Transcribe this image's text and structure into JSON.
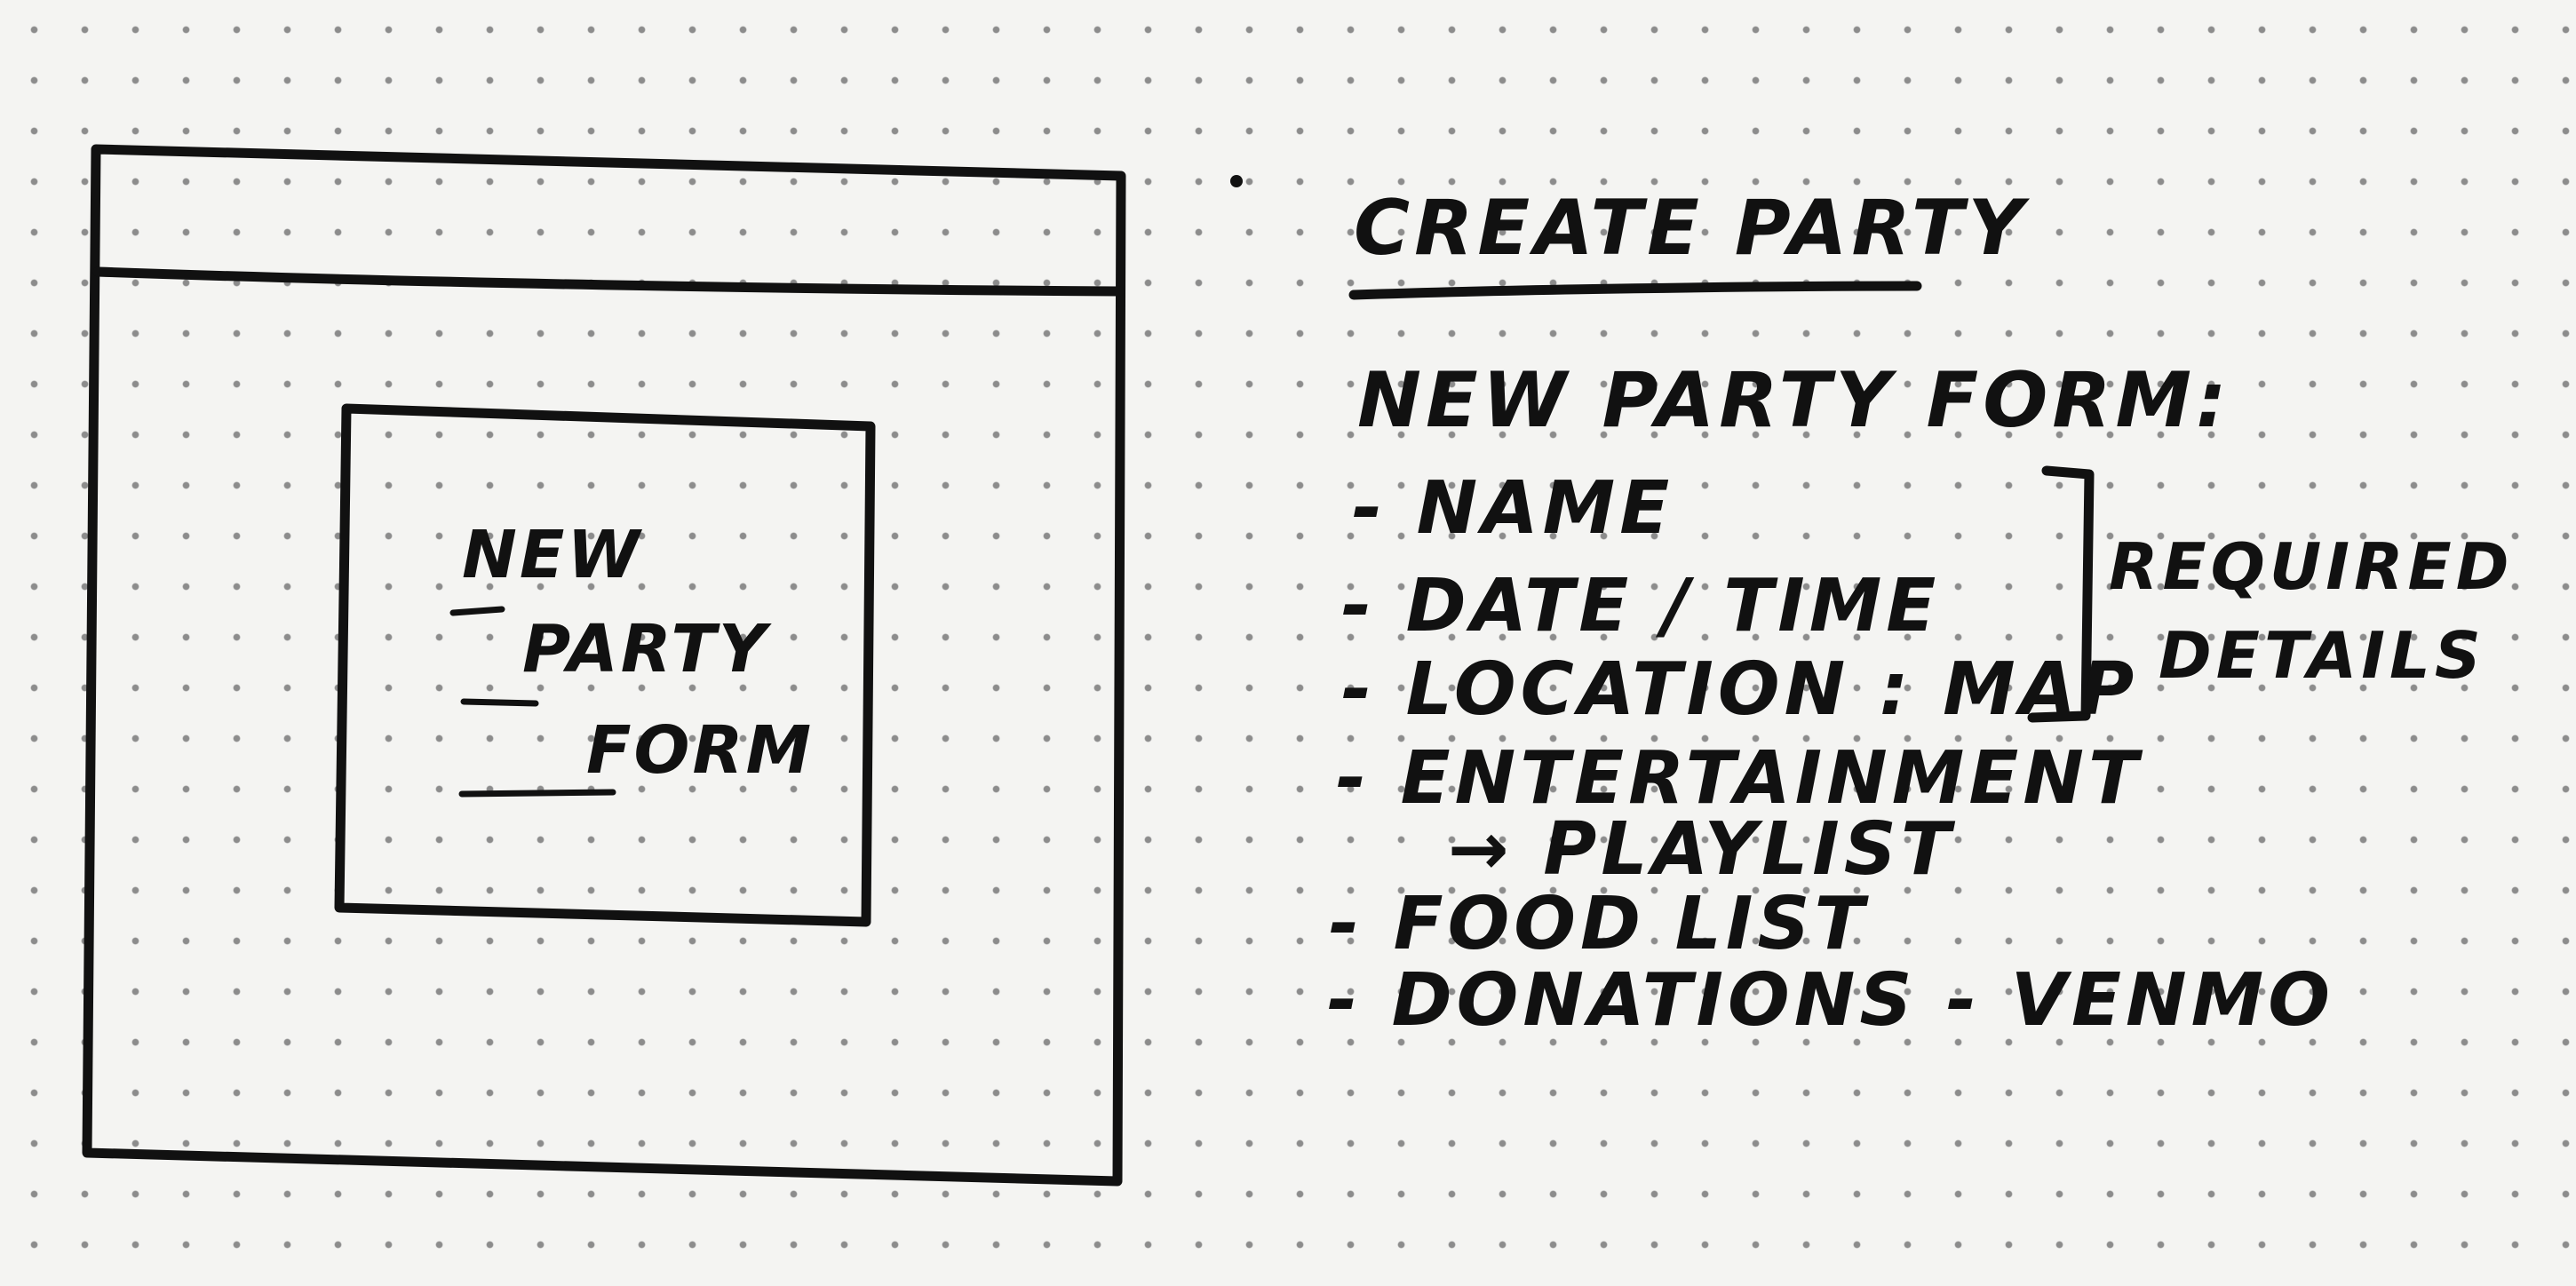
{
  "wireframe": {
    "form_lines": [
      "NEW",
      "PARTY",
      "FORM"
    ]
  },
  "notes": {
    "title": "CREATE PARTY",
    "form_heading": "NEW PARTY FORM:",
    "items": [
      "- NAME",
      "- DATE / TIME",
      "- LOCATION : MAP",
      "- ENTERTAINMENT",
      "→ PLAYLIST",
      "- FOOD LIST",
      "- DONATIONS - VENMO"
    ],
    "bracket_label": [
      "REQUIRED",
      "DETAILS"
    ]
  },
  "style": {
    "ink": "#111111",
    "paper": "#f4f4f2",
    "dot": "#8c8c8c"
  }
}
